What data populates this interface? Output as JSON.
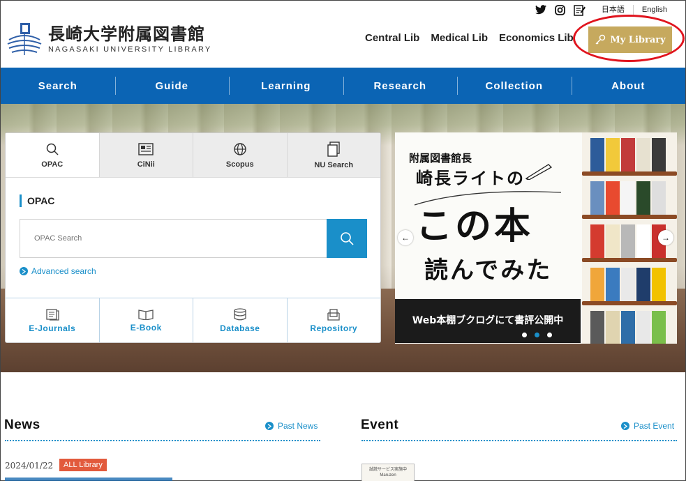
{
  "header": {
    "logo_ja": "長崎大学附属図書館",
    "logo_en": "NAGASAKI UNIVERSITY LIBRARY",
    "social_icons": [
      "twitter-icon",
      "instagram-icon",
      "blog-icon"
    ],
    "lang_ja": "日本語",
    "lang_en": "English",
    "lib_links": [
      "Central Lib",
      "Medical Lib",
      "Economics Lib"
    ],
    "my_library": "My Library",
    "my_library_color": "#c6a95e",
    "highlight_color": "#e0141e"
  },
  "global_nav": {
    "color": "#0b64b4",
    "items": [
      "Search",
      "Guide",
      "Learning",
      "Research",
      "Collection",
      "About"
    ]
  },
  "search_panel": {
    "tabs": [
      {
        "label": "OPAC",
        "icon": "search-icon",
        "active": true
      },
      {
        "label": "CiNii",
        "icon": "newspaper-icon",
        "active": false
      },
      {
        "label": "Scopus",
        "icon": "globe-icon",
        "active": false
      },
      {
        "label": "NU Search",
        "icon": "documents-icon",
        "active": false
      }
    ],
    "section_title": "OPAC",
    "input_placeholder": "OPAC Search",
    "advanced_search": "Advanced search",
    "quick_links": [
      {
        "label": "E-Journals",
        "icon": "journal-icon"
      },
      {
        "label": "E-Book",
        "icon": "book-icon"
      },
      {
        "label": "Database",
        "icon": "database-icon"
      },
      {
        "label": "Repository",
        "icon": "repository-icon"
      }
    ],
    "accent": "#1a8fc9"
  },
  "banner": {
    "line1": "附属図書館長",
    "line2": "崎長ライトの",
    "line3": "この本",
    "line4": "読んでみた",
    "caption": "Web本棚ブクログにて書評公開中",
    "slides_total": 3,
    "active_slide": 2
  },
  "news": {
    "title": "News",
    "past_link": "Past News",
    "item_date": "2024/01/22",
    "item_badge": "ALL Library"
  },
  "event": {
    "title": "Event",
    "past_link": "Past Event",
    "thumb_text": "試読サービス実施中 Maruzen"
  }
}
